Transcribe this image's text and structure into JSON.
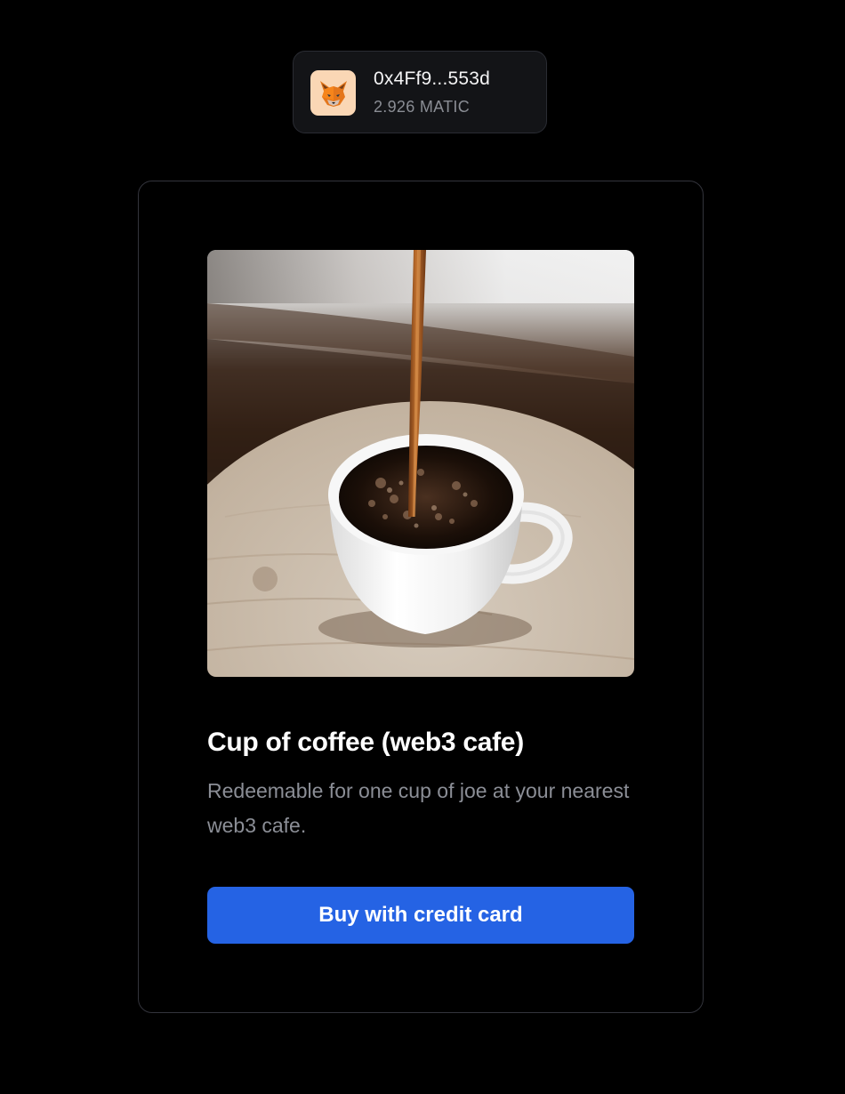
{
  "wallet": {
    "address": "0x4Ff9...553d",
    "balance": "2.926 MATIC",
    "icon": "metamask-fox-icon"
  },
  "product": {
    "image": "coffee-pour-photo",
    "title": "Cup of coffee (web3 cafe)",
    "description": "Redeemable for one cup of joe at your nearest web3 cafe.",
    "button_label": "Buy with credit card"
  },
  "colors": {
    "background": "#000000",
    "accent": "#2563e4",
    "muted_text": "#8b8e96",
    "card_border": "#33343c"
  }
}
